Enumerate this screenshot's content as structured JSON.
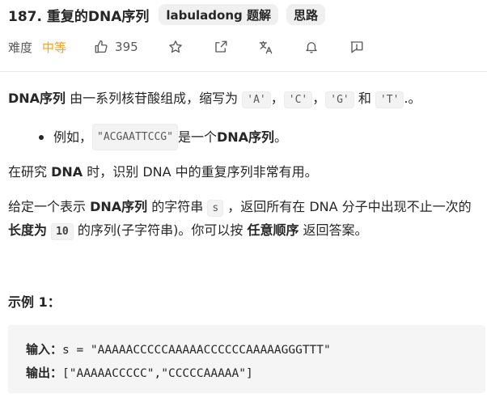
{
  "header": {
    "title": "187. 重复的DNA序列",
    "chips": [
      "labuladong 题解",
      "思路"
    ]
  },
  "meta": {
    "difficulty_label": "难度",
    "difficulty_value": "中等",
    "likes": "395",
    "icons": [
      "thumbs-up-icon",
      "star-icon",
      "share-icon",
      "translate-icon",
      "bell-icon",
      "feedback-icon"
    ],
    "difficulty_color": "#ffa116"
  },
  "description": {
    "p1_bold": "DNA序列",
    "p1_text1": " 由一系列核苷酸组成，缩写为 ",
    "code_a": "'A'",
    "sep1": "，",
    "code_c": "'C'",
    "sep2": "，",
    "code_g": "'G'",
    "and": " 和 ",
    "code_t": "'T'",
    "p1_end": ".。",
    "bullet_text1": "例如，",
    "bullet_code": "\"ACGAATTCCG\"",
    "bullet_text2": " 是一个 ",
    "bullet_bold": "DNA序列",
    "bullet_end": " 。",
    "p3_text1": "在研究 ",
    "p3_bold": "DNA",
    "p3_text2": " 时，识别 DNA 中的重复序列非常有用。",
    "p4_text1": "给定一个表示 ",
    "p4_bold1": "DNA序列",
    "p4_text2": " 的字符串 ",
    "p4_code_s": "s",
    "p4_text3": " ，返回所有在 DNA 分子中出现不止一次的 ",
    "p4_bold2": "长度为",
    "p4_code_10": "10",
    "p4_text4": " 的序列(子字符串)。你可以按 ",
    "p4_bold3": "任意顺序",
    "p4_text5": " 返回答案。"
  },
  "example": {
    "title": "示例 1：",
    "input_label": "输入：",
    "input_value": "s = \"AAAAACCCCCAAAAACCCCCCAAAAAGGGTTT\"",
    "output_label": "输出：",
    "output_value": "[\"AAAAACCCCC\",\"CCCCCAAAAA\"]"
  }
}
